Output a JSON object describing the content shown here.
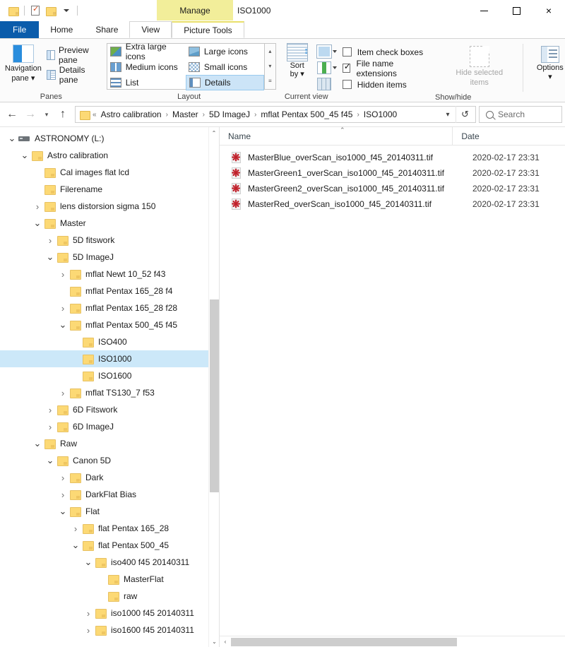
{
  "window": {
    "title": "ISO1000",
    "context_tab_banner": "Manage",
    "quick_access": [
      {
        "name": "folder-icon",
        "label": "Folder"
      },
      {
        "name": "properties-icon",
        "label": "Properties"
      },
      {
        "name": "new-folder-icon",
        "label": "New folder"
      },
      {
        "name": "customize-qat-icon",
        "label": "Customize Quick Access Toolbar"
      }
    ],
    "controls": {
      "minimize": "–",
      "maximize": "□",
      "close": "×"
    }
  },
  "tabs": [
    {
      "label": "File",
      "state": "file"
    },
    {
      "label": "Home",
      "state": "normal"
    },
    {
      "label": "Share",
      "state": "normal"
    },
    {
      "label": "View",
      "state": "active"
    },
    {
      "label": "Picture Tools",
      "state": "contextual"
    }
  ],
  "ribbon": {
    "groups": [
      {
        "label": "Panes",
        "big_button": {
          "label_line1": "Navigation",
          "label_line2": "pane",
          "icon": "navigation-pane-icon",
          "has_dropdown": true
        },
        "small_buttons": [
          {
            "label": "Preview pane",
            "icon": "preview-pane-icon"
          },
          {
            "label": "Details pane",
            "icon": "details-pane-icon"
          }
        ]
      },
      {
        "label": "Layout",
        "items": [
          {
            "label": "Extra large icons",
            "icon": "extra-large-icons-icon",
            "selected": false
          },
          {
            "label": "Large icons",
            "icon": "large-icons-icon",
            "selected": false
          },
          {
            "label": "Medium icons",
            "icon": "medium-icons-icon",
            "selected": false
          },
          {
            "label": "Small icons",
            "icon": "small-icons-icon",
            "selected": false
          },
          {
            "label": "List",
            "icon": "list-icon",
            "selected": false
          },
          {
            "label": "Details",
            "icon": "details-icon",
            "selected": true
          }
        ],
        "scroll": {
          "up": "▴",
          "down": "▾",
          "more": "☰"
        }
      },
      {
        "label": "Current view",
        "sort_by": {
          "label_line1": "Sort",
          "label_line2": "by",
          "icon": "sort-by-icon",
          "has_dropdown": true
        },
        "mini_buttons": [
          {
            "name": "add-columns-icon",
            "has_dropdown": true
          },
          {
            "name": "group-by-icon",
            "has_dropdown": true
          },
          {
            "name": "size-all-columns-icon",
            "has_dropdown": false
          }
        ]
      },
      {
        "label": "Show/hide",
        "checkboxes": [
          {
            "label": "Item check boxes",
            "checked": false
          },
          {
            "label": "File name extensions",
            "checked": true
          },
          {
            "label": "Hidden items",
            "checked": false
          }
        ],
        "hide_selected": {
          "label_line1": "Hide selected",
          "label_line2": "items",
          "icon": "hide-selected-items-icon",
          "disabled": true
        },
        "options": {
          "label": "Options",
          "icon": "options-icon",
          "has_dropdown": true
        }
      }
    ]
  },
  "addressbar": {
    "back": "←",
    "forward": "→",
    "recent": "⌄",
    "up": "↑",
    "overflow": "«",
    "crumbs": [
      "Astro calibration",
      "Master",
      "5D ImageJ",
      "mflat Pentax 500_45 f45",
      "ISO1000"
    ],
    "separator": "›",
    "dropdown": "⌄",
    "refresh": "↺",
    "search_placeholder": "Search"
  },
  "navigation_pane": {
    "scroll": {
      "up": "⌃",
      "down": "⌄"
    },
    "tree": [
      {
        "label": "ASTRONOMY (L:)",
        "depth": 0,
        "toggle": "open",
        "icon": "drive-icon",
        "selected": false
      },
      {
        "label": "Astro calibration",
        "depth": 1,
        "toggle": "open",
        "icon": "folder-icon",
        "selected": false
      },
      {
        "label": "Cal images flat lcd",
        "depth": 2,
        "toggle": "none",
        "icon": "folder-icon",
        "selected": false
      },
      {
        "label": "Filerename",
        "depth": 2,
        "toggle": "none",
        "icon": "folder-icon",
        "selected": false
      },
      {
        "label": "lens distorsion sigma 150",
        "depth": 2,
        "toggle": "closed",
        "icon": "folder-icon",
        "selected": false
      },
      {
        "label": "Master",
        "depth": 2,
        "toggle": "open",
        "icon": "folder-icon",
        "selected": false
      },
      {
        "label": "5D fitswork",
        "depth": 3,
        "toggle": "closed",
        "icon": "folder-icon",
        "selected": false
      },
      {
        "label": "5D ImageJ",
        "depth": 3,
        "toggle": "open",
        "icon": "folder-icon",
        "selected": false
      },
      {
        "label": "mflat Newt 10_52 f43",
        "depth": 4,
        "toggle": "closed",
        "icon": "folder-icon",
        "selected": false
      },
      {
        "label": "mflat Pentax 165_28 f4",
        "depth": 4,
        "toggle": "none",
        "icon": "folder-icon",
        "selected": false
      },
      {
        "label": "mflat Pentax 165_28 f28",
        "depth": 4,
        "toggle": "closed",
        "icon": "folder-icon",
        "selected": false
      },
      {
        "label": "mflat Pentax 500_45 f45",
        "depth": 4,
        "toggle": "open",
        "icon": "folder-icon",
        "selected": false
      },
      {
        "label": "ISO400",
        "depth": 5,
        "toggle": "none",
        "icon": "folder-icon",
        "selected": false
      },
      {
        "label": "ISO1000",
        "depth": 5,
        "toggle": "none",
        "icon": "folder-icon",
        "selected": true
      },
      {
        "label": "ISO1600",
        "depth": 5,
        "toggle": "none",
        "icon": "folder-icon",
        "selected": false
      },
      {
        "label": "mflat TS130_7 f53",
        "depth": 4,
        "toggle": "closed",
        "icon": "folder-icon",
        "selected": false
      },
      {
        "label": "6D Fitswork",
        "depth": 3,
        "toggle": "closed",
        "icon": "folder-icon",
        "selected": false
      },
      {
        "label": "6D ImageJ",
        "depth": 3,
        "toggle": "closed",
        "icon": "folder-icon",
        "selected": false
      },
      {
        "label": "Raw",
        "depth": 2,
        "toggle": "open",
        "icon": "folder-icon",
        "selected": false
      },
      {
        "label": "Canon 5D",
        "depth": 3,
        "toggle": "open",
        "icon": "folder-icon",
        "selected": false
      },
      {
        "label": "Dark",
        "depth": 4,
        "toggle": "closed",
        "icon": "folder-icon",
        "selected": false
      },
      {
        "label": "DarkFlat Bias",
        "depth": 4,
        "toggle": "closed",
        "icon": "folder-icon",
        "selected": false
      },
      {
        "label": "Flat",
        "depth": 4,
        "toggle": "open",
        "icon": "folder-icon",
        "selected": false
      },
      {
        "label": "flat Pentax 165_28",
        "depth": 5,
        "toggle": "closed",
        "icon": "folder-icon",
        "selected": false
      },
      {
        "label": "flat Pentax 500_45",
        "depth": 5,
        "toggle": "open",
        "icon": "folder-icon",
        "selected": false
      },
      {
        "label": "iso400 f45 20140311",
        "depth": 6,
        "toggle": "open",
        "icon": "folder-icon",
        "selected": false
      },
      {
        "label": "MasterFlat",
        "depth": 7,
        "toggle": "none",
        "icon": "folder-icon",
        "selected": false
      },
      {
        "label": "raw",
        "depth": 7,
        "toggle": "none",
        "icon": "folder-icon",
        "selected": false
      },
      {
        "label": "iso1000 f45 20140311",
        "depth": 6,
        "toggle": "closed",
        "icon": "folder-icon",
        "selected": false
      },
      {
        "label": "iso1600 f45 20140311",
        "depth": 6,
        "toggle": "closed",
        "icon": "folder-icon",
        "selected": false
      }
    ]
  },
  "file_pane": {
    "columns": [
      {
        "label": "Name",
        "sort": "asc"
      },
      {
        "label": "Date",
        "sort": "none"
      }
    ],
    "sort_indicator": "⌃",
    "rows": [
      {
        "name": "MasterBlue_overScan_iso1000_f45_20140311.tif",
        "date": "2020-02-17 23:31",
        "icon": "tif-file-icon"
      },
      {
        "name": "MasterGreen1_overScan_iso1000_f45_20140311.tif",
        "date": "2020-02-17 23:31",
        "icon": "tif-file-icon"
      },
      {
        "name": "MasterGreen2_overScan_iso1000_f45_20140311.tif",
        "date": "2020-02-17 23:31",
        "icon": "tif-file-icon"
      },
      {
        "name": "MasterRed_overScan_iso1000_f45_20140311.tif",
        "date": "2020-02-17 23:31",
        "icon": "tif-file-icon"
      }
    ],
    "hscroll": {
      "left": "‹",
      "right": "›"
    }
  },
  "colors": {
    "accent": "#0b5cab",
    "selection": "#cce8f9",
    "contextual_tab": "#f2ee9a",
    "folder": "#fcd975",
    "tif_icon": "#c0202a"
  }
}
